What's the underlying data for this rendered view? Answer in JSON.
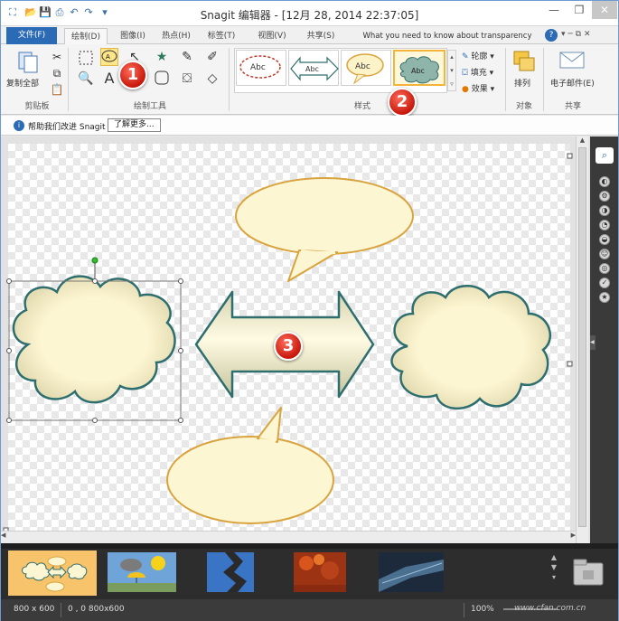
{
  "window": {
    "title": "Snagit 编辑器 - [12月 28, 2014 22:37:05]",
    "min_label": "—",
    "restore_label": "❐",
    "close_label": "✕"
  },
  "tabs": [
    {
      "label": "文件(F)"
    },
    {
      "label": "绘制(D)"
    },
    {
      "label": "图像(I)"
    },
    {
      "label": "热点(H)"
    },
    {
      "label": "标签(T)"
    },
    {
      "label": "视图(V)"
    },
    {
      "label": "共享(S)"
    }
  ],
  "help_text": "What you need to know about transparency",
  "ribbon": {
    "clipboard": {
      "copy_all": "复制全部",
      "group": "剪贴板"
    },
    "drawing_tools_group": "绘制工具",
    "styles": {
      "items": [
        "Abc",
        "Abc",
        "Abc",
        "Abc"
      ],
      "group": "样式"
    },
    "outline": "轮廓",
    "fill": "填充",
    "effects": "效果",
    "object": {
      "arrange": "排列",
      "group": "对象"
    },
    "share": {
      "email": "电子邮件(E)",
      "group": "共享"
    }
  },
  "infobar": {
    "text": "帮助我们改进 Snagit",
    "button": "了解更多..."
  },
  "badges": [
    "1",
    "2",
    "3"
  ],
  "status": {
    "size": "800 x 600",
    "coords": "0 , 0  800x600",
    "zoom": "100%"
  },
  "watermark": "www.cfan.com.cn",
  "colors": {
    "accent": "#2b6ab4",
    "badge": "#d8261a",
    "shape_fill": "#fdf6d2",
    "cloud_stroke": "#2f6e6e",
    "bubble_stroke": "#d9a440"
  }
}
